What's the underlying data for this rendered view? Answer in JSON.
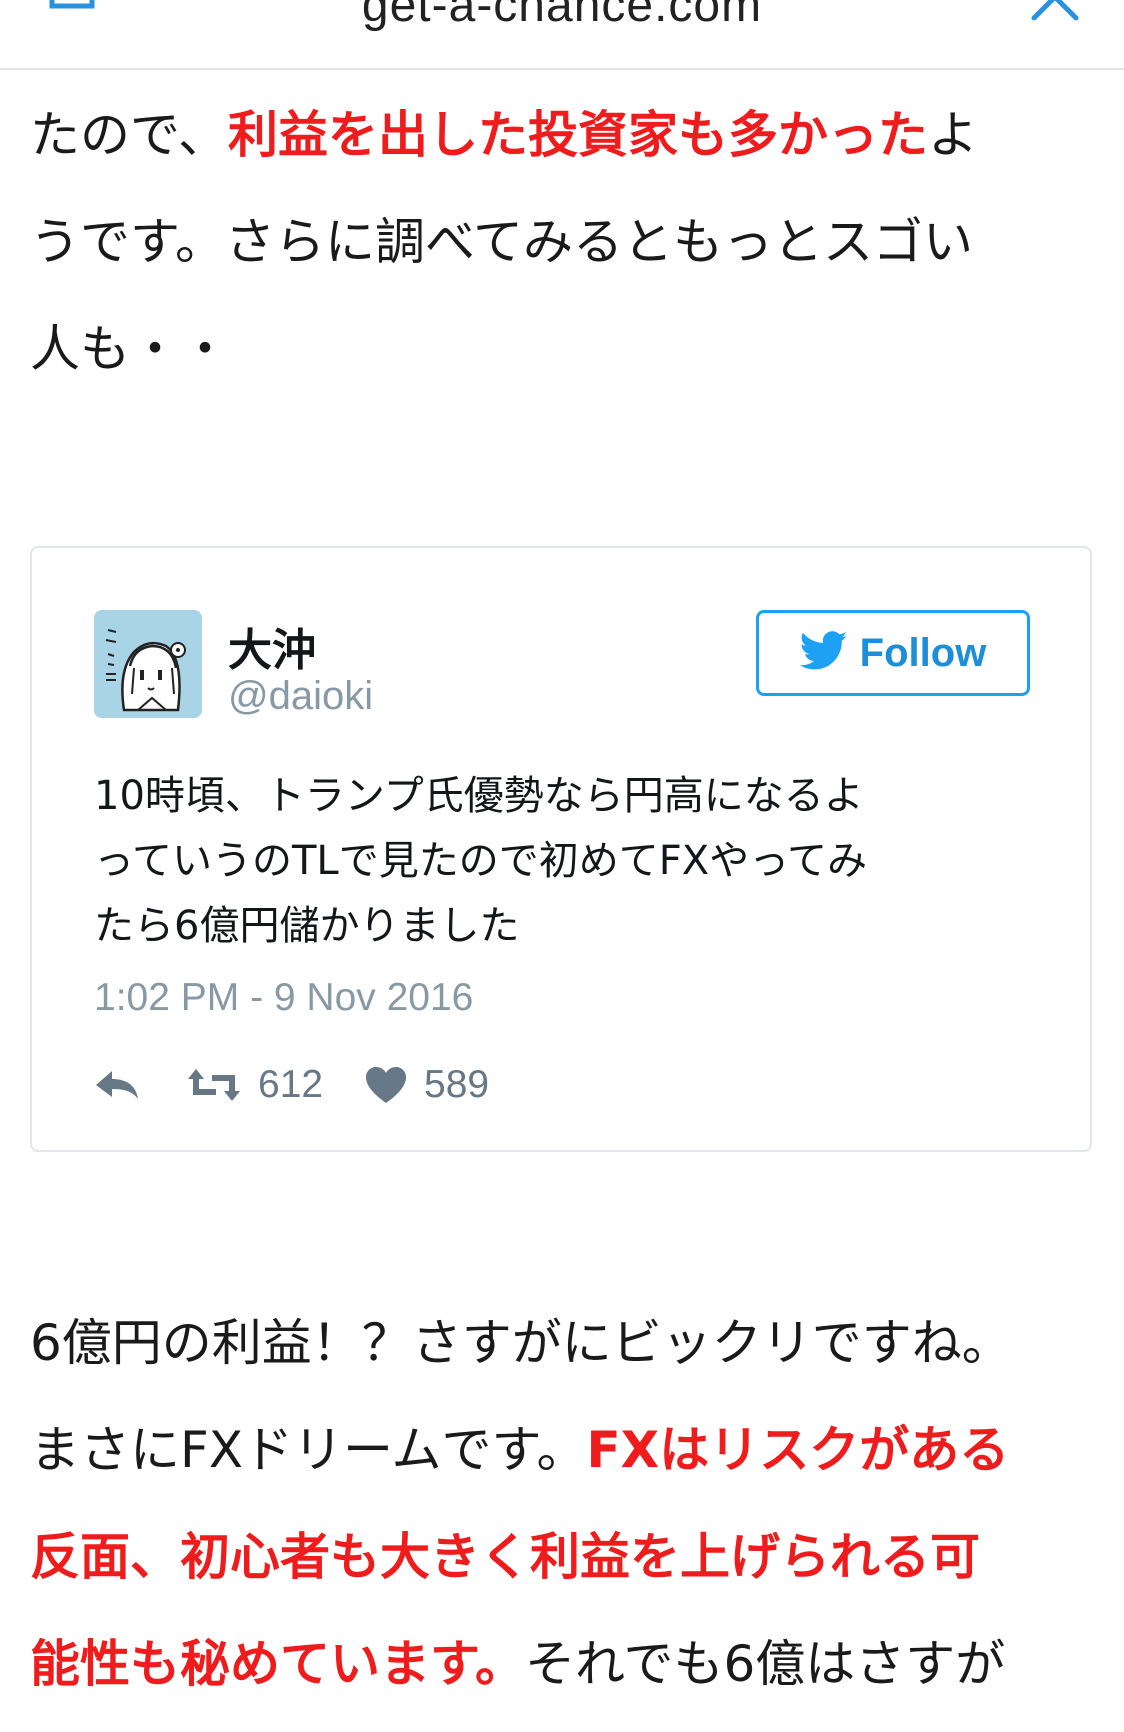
{
  "browser": {
    "domain": "get-a-chance.com",
    "share_icon": "share-icon",
    "close_icon": "close-icon",
    "accent_color": "#2a90e0"
  },
  "article": {
    "paragraph_1": {
      "line_1": {
        "a": "たので、",
        "b_highlight": "利益を出した投資家も多かった",
        "c": "よ"
      },
      "line_2": "うです。さらに調べてみるともっとスゴい",
      "line_3": "人も・・"
    },
    "paragraph_2": {
      "line_1": "6億円の利益！？さすがにビックリですね。",
      "line_2": {
        "a": "まさにFXドリームです。",
        "b_highlight": "FXはリスクがある"
      },
      "line_3_highlight": "反面、初心者も大きく利益を上げられる可",
      "line_4": {
        "a_highlight": "能性も秘めています。",
        "b": "それでも6億はさすが"
      }
    },
    "highlight_color": "#ee1c1c"
  },
  "tweet": {
    "author_name": "大沖",
    "author_handle": "@daioki",
    "follow_label": "Follow",
    "follow_icon": "twitter-bird-icon",
    "text_lines": [
      "10時頃、トランプ氏優勢なら円高になるよ",
      "っていうのTLで見たので初めてFXやってみ",
      "たら6億円儲かりました"
    ],
    "timestamp": "1:02 PM - 9 Nov 2016",
    "reply_icon": "reply-icon",
    "retweet_icon": "retweet-icon",
    "retweet_count": "612",
    "like_icon": "heart-icon",
    "like_count": "589",
    "brand_color": "#1da1f2"
  }
}
